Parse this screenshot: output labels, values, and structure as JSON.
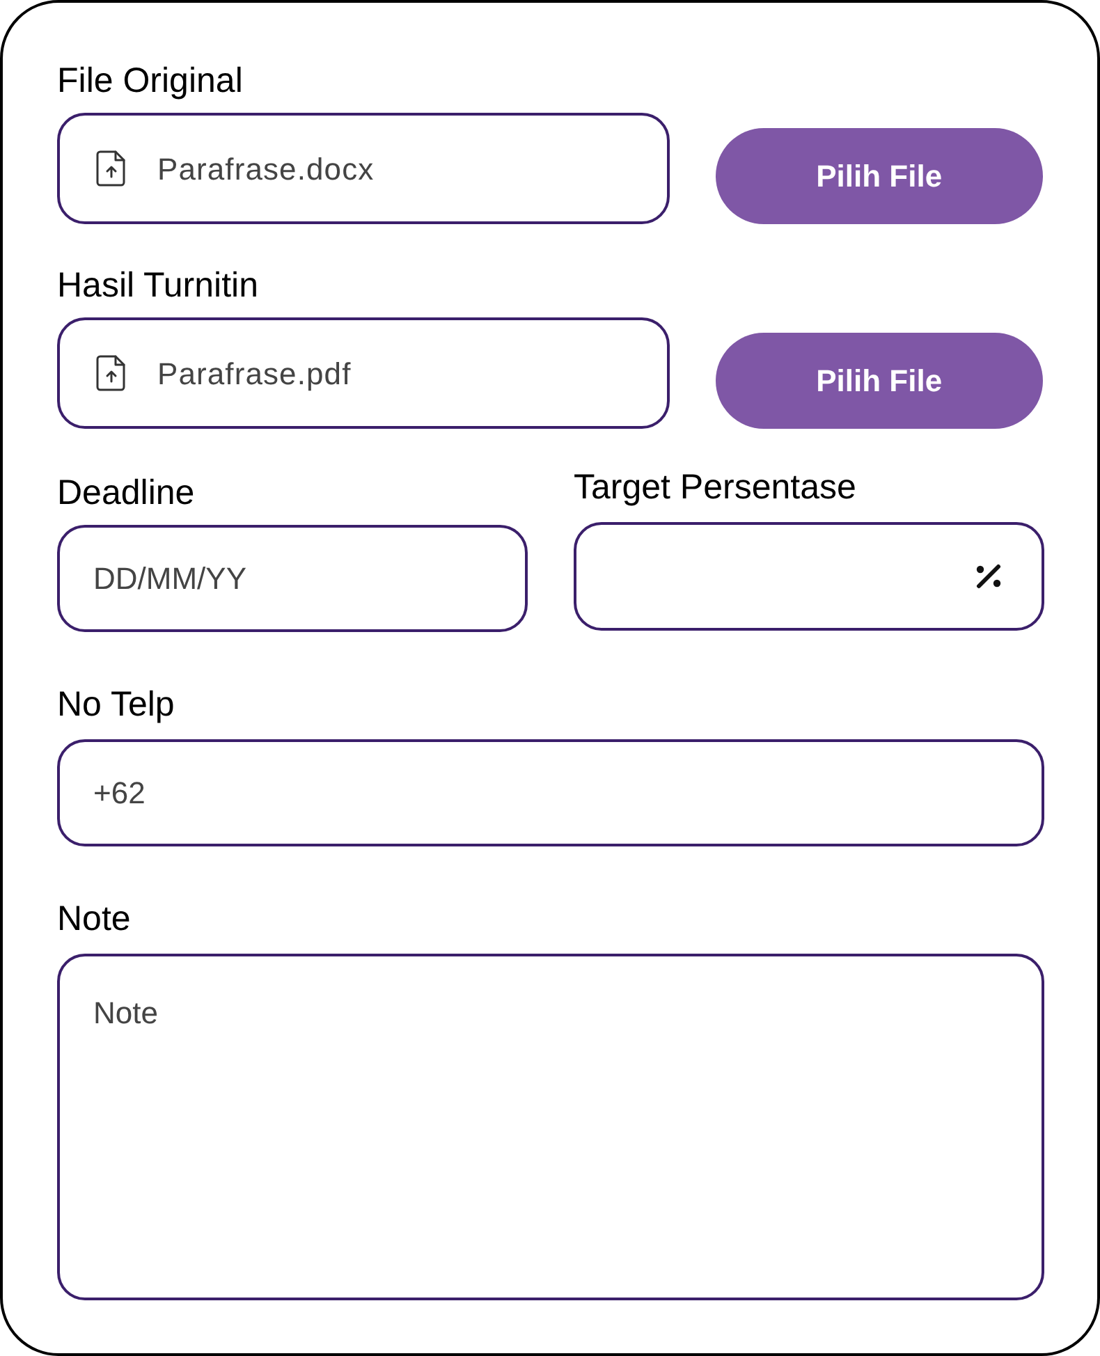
{
  "file_original": {
    "label": "File Original",
    "value": "Parafrase.docx",
    "button": "Pilih File"
  },
  "hasil_turnitin": {
    "label": "Hasil Turnitin",
    "value": "Parafrase.pdf",
    "button": "Pilih File"
  },
  "deadline": {
    "label": "Deadline",
    "placeholder": "DD/MM/YY"
  },
  "target_persentase": {
    "label": "Target Persentase"
  },
  "no_telp": {
    "label": "No Telp",
    "placeholder": "+62"
  },
  "note": {
    "label": "Note",
    "placeholder": "Note"
  }
}
